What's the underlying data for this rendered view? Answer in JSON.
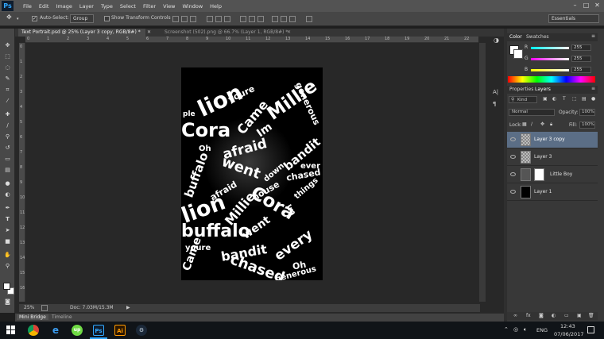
{
  "menubar": {
    "logo": "Ps",
    "items": [
      "File",
      "Edit",
      "Image",
      "Layer",
      "Type",
      "Select",
      "Filter",
      "View",
      "Window",
      "Help"
    ]
  },
  "options": {
    "auto_select_label": "Auto-Select:",
    "auto_select_value": "Group",
    "transform_label": "Show Transform Controls",
    "workspace": "Essentials"
  },
  "tabs": [
    {
      "label": "Text Portrait.psd @ 25% (Layer 3 copy, RGB/8#) *",
      "active": true
    },
    {
      "label": "Screenshot (502).png @ 66.7% (Layer 1, RGB/8#) *",
      "active": false
    }
  ],
  "ruler_top": [
    "0",
    "1",
    "2",
    "3",
    "4",
    "5",
    "6",
    "7",
    "8",
    "9",
    "10",
    "11",
    "12",
    "13",
    "14",
    "15",
    "16",
    "17",
    "18",
    "19",
    "20",
    "21",
    "22"
  ],
  "ruler_left": [
    "0",
    "1",
    "2",
    "3",
    "4",
    "5",
    "6",
    "7",
    "8",
    "9",
    "10",
    "11",
    "12",
    "13",
    "14",
    "15",
    "16"
  ],
  "status": {
    "zoom": "25%",
    "doc": "Doc: 7.03M/15.3M"
  },
  "bottom_tabs": [
    "Mini Bridge",
    "Timeline"
  ],
  "color_panel": {
    "tabs": [
      "Color",
      "Swatches"
    ],
    "r_label": "R",
    "g_label": "G",
    "b_label": "B",
    "r": "255",
    "g": "255",
    "b": "255"
  },
  "layers_panel": {
    "tabs": [
      "Properties",
      "Layers"
    ],
    "kind": "Kind",
    "blend": "Normal",
    "opacity_label": "Opacity:",
    "opacity": "100%",
    "lock_label": "Lock:",
    "fill_label": "Fill:",
    "fill": "100%",
    "layers": [
      "Layer 3 copy",
      "Layer 3",
      "Little Boy",
      "Layer 1"
    ]
  },
  "artwork_words": [
    "lion",
    "Cora",
    "Millie",
    "Came",
    "afraid",
    "buffalo",
    "went",
    "bandit",
    "chased",
    "generous",
    "youre",
    "Im",
    "Oh",
    "down",
    "house",
    "ever",
    "things",
    "lion",
    "Cora",
    "Millie",
    "Came",
    "afraid",
    "buffalo",
    "went",
    "bandit",
    "every",
    "chased",
    "youre",
    "Im",
    "Oh",
    "generous",
    "ple"
  ],
  "taskbar": {
    "language": "ENG",
    "time": "12:43",
    "date": "07/06/2017",
    "apps": [
      "Ps",
      "Ai"
    ]
  },
  "colors": {
    "accent": "#31a8ff",
    "illustrator": "#ff9a00",
    "selected_layer": "#5b6e86"
  }
}
